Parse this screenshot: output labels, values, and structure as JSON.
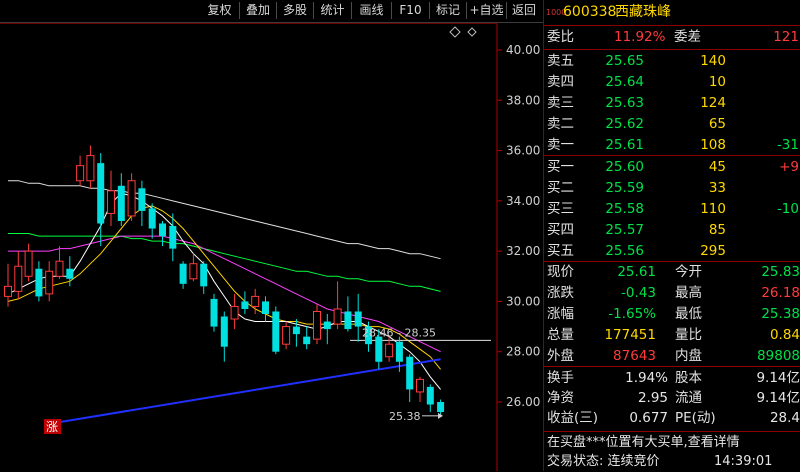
{
  "toolbar": {
    "buttons": [
      "复权",
      "叠加",
      "多股",
      "统计",
      "画线",
      "F10",
      "标记",
      "+自选",
      "返回"
    ]
  },
  "chart": {
    "y_ticks": [
      "40.00",
      "38.00",
      "36.00",
      "34.00",
      "32.00",
      "30.00",
      "28.00",
      "26.00"
    ],
    "annotation_range": "28.46 - 28.35",
    "annotation_low": "25.38",
    "zhang_badge": "涨",
    "corner_icon": "diamond-icon",
    "colors": {
      "up": "#ff3b3b",
      "down": "#00e0e0",
      "ma5": "#ffffff",
      "ma10": "#ffd400",
      "ma20": "#ff40ff",
      "ma30": "#00ff40",
      "ma60": "#e0e0e0",
      "trend": "#2030ff"
    }
  },
  "chart_data": {
    "type": "candlestick",
    "ylim": [
      25,
      41
    ],
    "candles": [
      {
        "o": 30.2,
        "c": 30.6,
        "h": 31.5,
        "l": 29.8
      },
      {
        "o": 30.4,
        "c": 31.4,
        "h": 32.0,
        "l": 30.1
      },
      {
        "o": 31.0,
        "c": 32.0,
        "h": 32.3,
        "l": 30.8
      },
      {
        "o": 31.3,
        "c": 30.2,
        "h": 31.6,
        "l": 30.0
      },
      {
        "o": 30.3,
        "c": 31.2,
        "h": 31.6,
        "l": 30.0
      },
      {
        "o": 31.0,
        "c": 31.6,
        "h": 32.2,
        "l": 30.9
      },
      {
        "o": 31.3,
        "c": 30.9,
        "h": 31.8,
        "l": 30.6
      },
      {
        "o": 34.8,
        "c": 35.4,
        "h": 35.8,
        "l": 34.6
      },
      {
        "o": 34.8,
        "c": 35.8,
        "h": 36.2,
        "l": 34.5
      },
      {
        "o": 35.5,
        "c": 33.1,
        "h": 35.9,
        "l": 32.2
      },
      {
        "o": 33.5,
        "c": 34.4,
        "h": 35.2,
        "l": 33.0
      },
      {
        "o": 34.6,
        "c": 33.2,
        "h": 35.1,
        "l": 33.0
      },
      {
        "o": 33.4,
        "c": 34.8,
        "h": 35.1,
        "l": 33.2
      },
      {
        "o": 34.5,
        "c": 33.6,
        "h": 34.8,
        "l": 33.0
      },
      {
        "o": 33.7,
        "c": 32.9,
        "h": 33.9,
        "l": 32.5
      },
      {
        "o": 33.1,
        "c": 32.6,
        "h": 33.2,
        "l": 32.2
      },
      {
        "o": 33.0,
        "c": 32.1,
        "h": 33.5,
        "l": 31.6
      },
      {
        "o": 31.5,
        "c": 30.7,
        "h": 31.6,
        "l": 30.5
      },
      {
        "o": 30.9,
        "c": 31.5,
        "h": 31.9,
        "l": 30.8
      },
      {
        "o": 31.5,
        "c": 30.6,
        "h": 31.6,
        "l": 30.3
      },
      {
        "o": 30.1,
        "c": 29.0,
        "h": 30.3,
        "l": 28.8
      },
      {
        "o": 29.4,
        "c": 28.2,
        "h": 29.6,
        "l": 27.6
      },
      {
        "o": 29.3,
        "c": 29.8,
        "h": 30.3,
        "l": 28.9
      },
      {
        "o": 30.0,
        "c": 29.7,
        "h": 30.4,
        "l": 29.5
      },
      {
        "o": 29.8,
        "c": 30.2,
        "h": 30.5,
        "l": 29.5
      },
      {
        "o": 30.0,
        "c": 29.5,
        "h": 30.2,
        "l": 29.2
      },
      {
        "o": 29.6,
        "c": 28.0,
        "h": 29.8,
        "l": 27.9
      },
      {
        "o": 28.3,
        "c": 29.0,
        "h": 29.2,
        "l": 28.1
      },
      {
        "o": 29.0,
        "c": 28.7,
        "h": 29.3,
        "l": 28.2
      },
      {
        "o": 28.6,
        "c": 28.3,
        "h": 29.0,
        "l": 28.1
      },
      {
        "o": 28.5,
        "c": 29.6,
        "h": 29.9,
        "l": 28.3
      },
      {
        "o": 29.2,
        "c": 28.9,
        "h": 29.5,
        "l": 28.3
      },
      {
        "o": 29.1,
        "c": 29.7,
        "h": 30.8,
        "l": 28.9
      },
      {
        "o": 29.6,
        "c": 28.9,
        "h": 30.2,
        "l": 28.8
      },
      {
        "o": 29.6,
        "c": 29.0,
        "h": 30.3,
        "l": 28.4
      },
      {
        "o": 29.0,
        "c": 28.3,
        "h": 29.2,
        "l": 28.0
      },
      {
        "o": 28.6,
        "c": 27.6,
        "h": 28.9,
        "l": 27.3
      },
      {
        "o": 27.8,
        "c": 28.3,
        "h": 28.6,
        "l": 27.6
      },
      {
        "o": 28.4,
        "c": 27.6,
        "h": 28.6,
        "l": 27.2
      },
      {
        "o": 27.8,
        "c": 26.5,
        "h": 27.9,
        "l": 26.0
      },
      {
        "o": 26.4,
        "c": 26.9,
        "h": 27.0,
        "l": 26.0
      },
      {
        "o": 26.6,
        "c": 25.9,
        "h": 26.7,
        "l": 25.6
      },
      {
        "o": 26.0,
        "c": 25.6,
        "h": 26.1,
        "l": 25.4
      }
    ],
    "ma_lines": {
      "ma5": [
        30.3,
        30.5,
        30.7,
        30.9,
        31.0,
        31.0,
        31.0,
        31.6,
        32.3,
        33.0,
        33.9,
        34.3,
        34.2,
        34.0,
        33.7,
        33.4,
        33.0,
        32.4,
        31.9,
        31.5,
        30.8,
        30.2,
        29.6,
        29.3,
        29.2,
        29.2,
        29.2,
        29.2,
        29.1,
        29.0,
        28.9,
        29.0,
        29.2,
        29.2,
        29.2,
        29.0,
        28.8,
        28.6,
        28.3,
        28.0,
        27.6,
        27.0,
        26.5
      ],
      "ma10": [
        30.0,
        30.1,
        30.3,
        30.5,
        30.6,
        30.7,
        30.8,
        31.1,
        31.5,
        31.9,
        32.4,
        32.9,
        33.4,
        33.7,
        33.8,
        33.6,
        33.3,
        32.9,
        32.4,
        31.9,
        31.4,
        30.9,
        30.4,
        30.0,
        29.7,
        29.5,
        29.3,
        29.2,
        29.2,
        29.1,
        29.1,
        29.1,
        29.1,
        29.1,
        29.1,
        29.0,
        29.0,
        28.9,
        28.7,
        28.4,
        28.1,
        27.8,
        27.3
      ],
      "ma20": [
        32.0,
        32.0,
        32.0,
        32.0,
        32.0,
        32.1,
        32.1,
        32.2,
        32.3,
        32.4,
        32.5,
        32.6,
        32.6,
        32.6,
        32.6,
        32.6,
        32.5,
        32.4,
        32.3,
        32.1,
        31.9,
        31.7,
        31.5,
        31.3,
        31.1,
        30.9,
        30.7,
        30.5,
        30.3,
        30.1,
        29.9,
        29.7,
        29.6,
        29.5,
        29.4,
        29.3,
        29.2,
        29.0,
        28.8,
        28.6,
        28.4,
        28.2,
        28.0
      ],
      "ma30": [
        32.7,
        32.7,
        32.7,
        32.6,
        32.6,
        32.6,
        32.6,
        32.6,
        32.6,
        32.6,
        32.6,
        32.6,
        32.5,
        32.5,
        32.4,
        32.4,
        32.3,
        32.3,
        32.2,
        32.1,
        32.0,
        31.9,
        31.8,
        31.7,
        31.6,
        31.5,
        31.4,
        31.3,
        31.2,
        31.2,
        31.1,
        31.0,
        31.0,
        30.9,
        30.9,
        30.8,
        30.8,
        30.8,
        30.7,
        30.6,
        30.6,
        30.5,
        30.4
      ],
      "ma60": [
        34.8,
        34.8,
        34.7,
        34.7,
        34.6,
        34.6,
        34.6,
        34.6,
        34.5,
        34.5,
        34.4,
        34.4,
        34.3,
        34.3,
        34.2,
        34.1,
        34.0,
        33.9,
        33.8,
        33.7,
        33.6,
        33.5,
        33.4,
        33.3,
        33.2,
        33.1,
        33.0,
        32.9,
        32.8,
        32.7,
        32.6,
        32.5,
        32.4,
        32.3,
        32.3,
        32.2,
        32.1,
        32.1,
        32.0,
        31.9,
        31.9,
        31.8,
        31.7
      ]
    },
    "hline_level": 28.45,
    "trend_line": {
      "from_index": 5,
      "from_value": 25.2,
      "to_index": 42,
      "to_value": 27.7
    }
  },
  "quote": {
    "code_prefix": "1000",
    "code": "600338",
    "name": "西藏珠峰",
    "weibi_label": "委比",
    "weibi_value": "11.92%",
    "weicha_label": "委差",
    "weicha_value": "121",
    "sell": [
      {
        "label": "卖五",
        "price": "25.65",
        "vol": "140",
        "chg": ""
      },
      {
        "label": "卖四",
        "price": "25.64",
        "vol": "10",
        "chg": ""
      },
      {
        "label": "卖三",
        "price": "25.63",
        "vol": "124",
        "chg": ""
      },
      {
        "label": "卖二",
        "price": "25.62",
        "vol": "65",
        "chg": ""
      },
      {
        "label": "卖一",
        "price": "25.61",
        "vol": "108",
        "chg": "-31"
      }
    ],
    "buy": [
      {
        "label": "买一",
        "price": "25.60",
        "vol": "45",
        "chg": "+9"
      },
      {
        "label": "买二",
        "price": "25.59",
        "vol": "33",
        "chg": ""
      },
      {
        "label": "买三",
        "price": "25.58",
        "vol": "110",
        "chg": "-10"
      },
      {
        "label": "买四",
        "price": "25.57",
        "vol": "85",
        "chg": ""
      },
      {
        "label": "买五",
        "price": "25.56",
        "vol": "295",
        "chg": ""
      }
    ],
    "stats": [
      {
        "l1": "现价",
        "v1": "25.61",
        "c1": "down",
        "l2": "今开",
        "v2": "25.83",
        "c2": "down"
      },
      {
        "l1": "涨跌",
        "v1": "-0.43",
        "c1": "down",
        "l2": "最高",
        "v2": "26.18",
        "c2": "up"
      },
      {
        "l1": "涨幅",
        "v1": "-1.65%",
        "c1": "down",
        "l2": "最低",
        "v2": "25.38",
        "c2": "down"
      },
      {
        "l1": "总量",
        "v1": "177451",
        "c1": "yel",
        "l2": "量比",
        "v2": "0.84",
        "c2": "yel"
      },
      {
        "l1": "外盘",
        "v1": "87643",
        "c1": "up",
        "l2": "内盘",
        "v2": "89808",
        "c2": "down"
      }
    ],
    "fund": [
      {
        "l1": "换手",
        "v1": "1.94%",
        "l2": "股本",
        "v2": "9.14亿"
      },
      {
        "l1": "净资",
        "v1": "2.95",
        "l2": "流通",
        "v2": "9.14亿"
      },
      {
        "l1": "收益(三)",
        "v1": "0.677",
        "l2": "PE(动)",
        "v2": "28.4"
      }
    ],
    "notice": "在买盘***位置有大买单,查看详情",
    "status_label": "交易状态: 连续竞价",
    "status_time": "14:39:01"
  }
}
